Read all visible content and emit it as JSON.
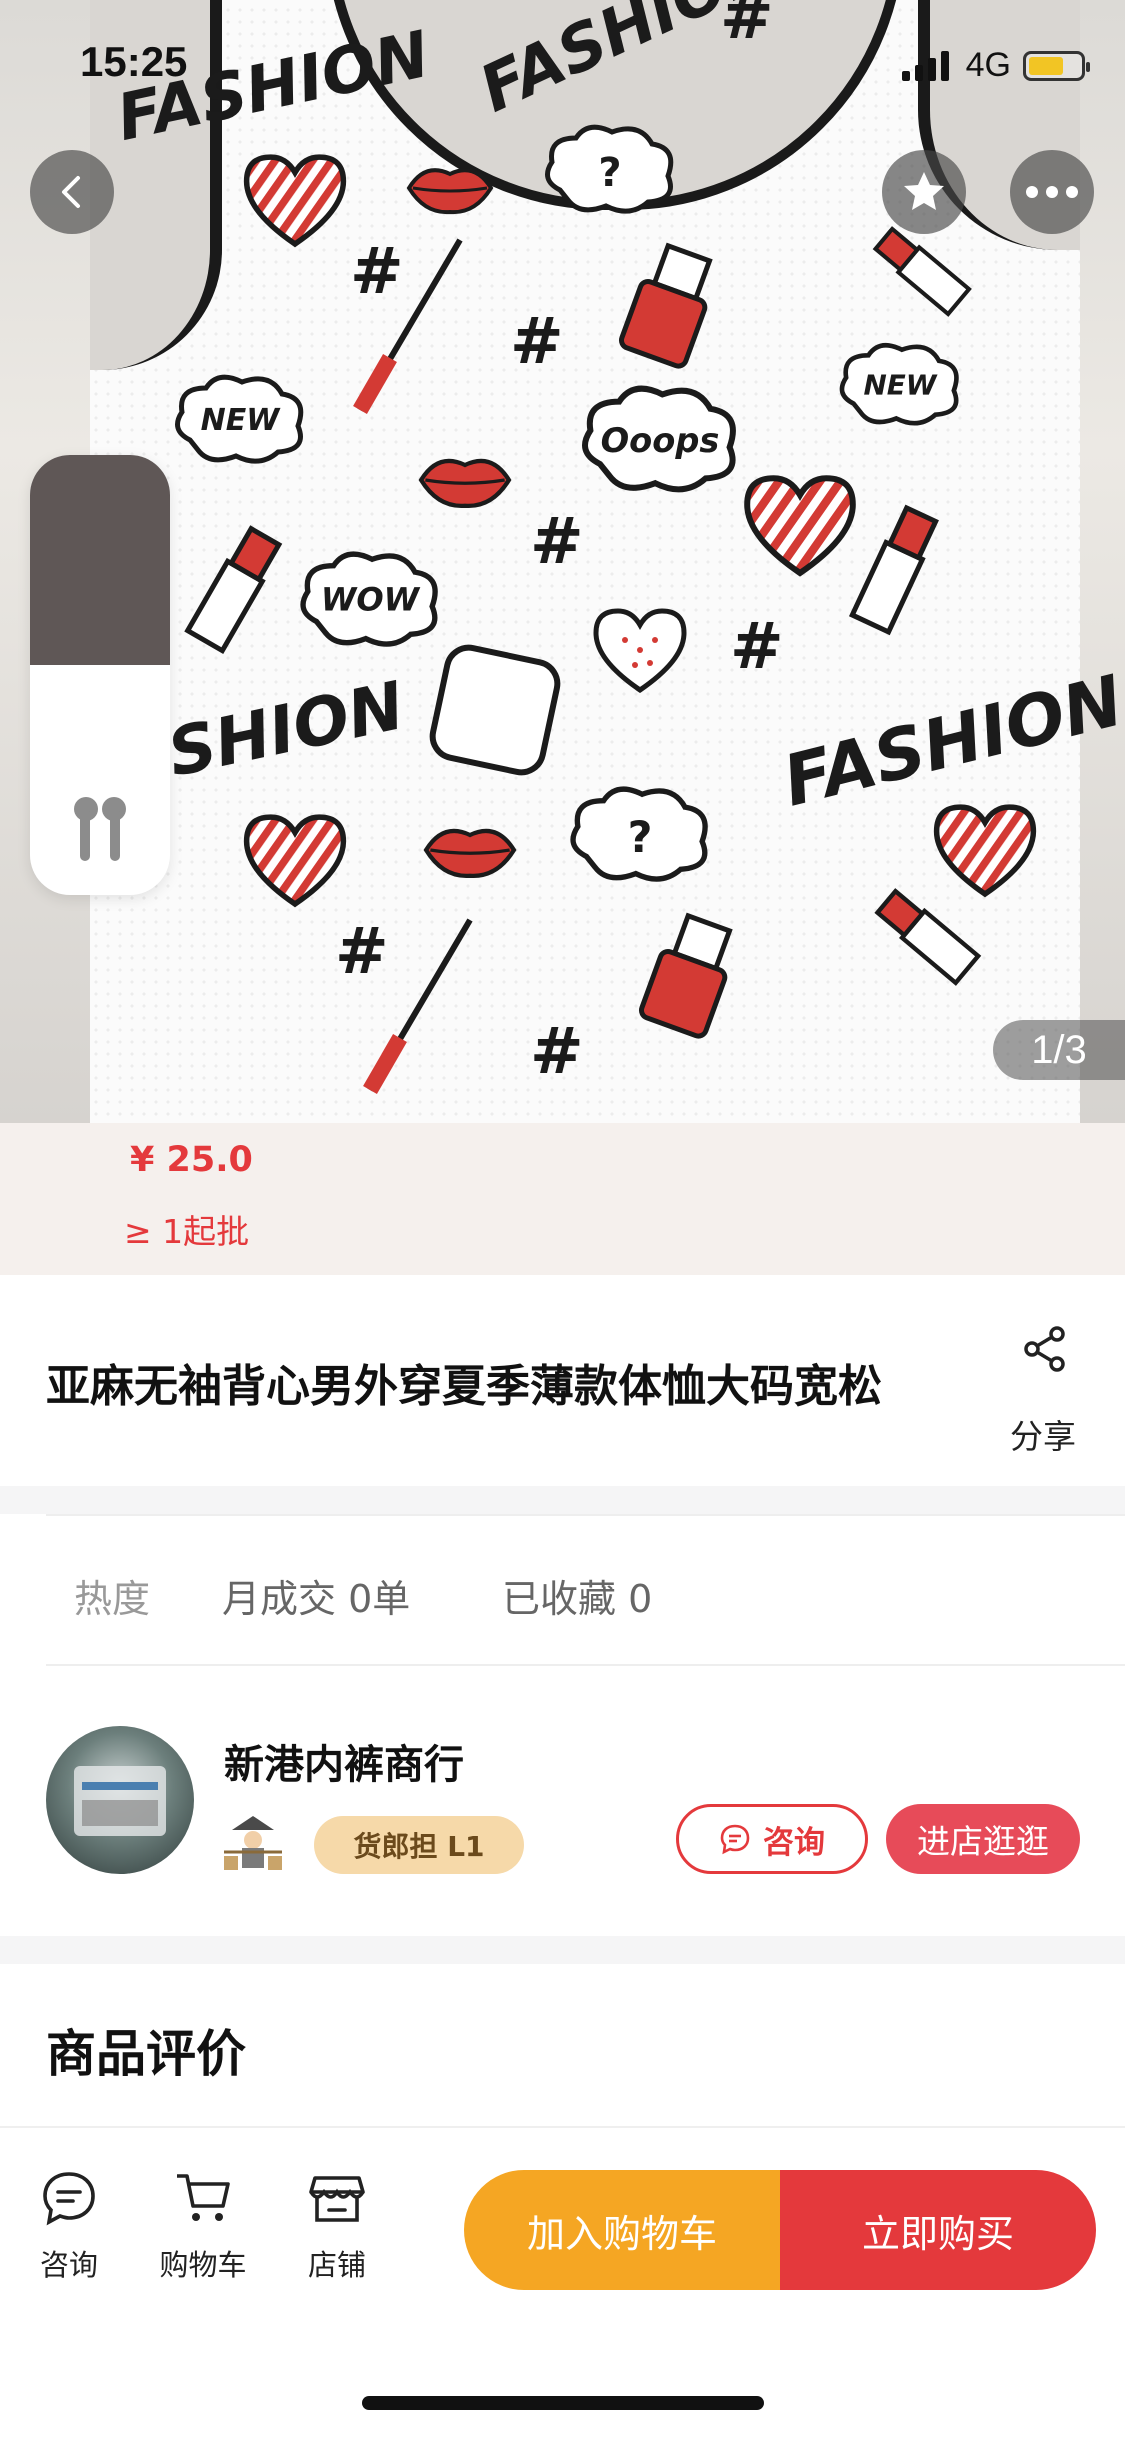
{
  "status_bar": {
    "time": "15:25",
    "network": "4G"
  },
  "gallery": {
    "page_indicator": "1/3",
    "print_words": {
      "fashion": "FASHION",
      "new": "NEW",
      "wow": "WOW",
      "ooops": "Ooops",
      "question": "?",
      "hash": "#"
    }
  },
  "price": {
    "value": "¥ 25.0",
    "min_qty": "≥ 1起批"
  },
  "product": {
    "title": "亚麻无袖背心男外穿夏季薄款体恤大码宽松",
    "share_label": "分享"
  },
  "stats": {
    "heat_label": "热度",
    "monthly_sales": "月成交 0单",
    "favorites": "已收藏 0"
  },
  "shop": {
    "name": "新港内裤商行",
    "level_badge": "货郎担 L1",
    "consult_label": "咨询",
    "visit_label": "进店逛逛"
  },
  "reviews": {
    "title": "商品评价"
  },
  "bottom_bar": {
    "consult": "咨询",
    "cart": "购物车",
    "store": "店铺",
    "add_to_cart": "加入购物车",
    "buy_now": "立即购买"
  },
  "colors": {
    "accent_red": "#e4393c",
    "cart_orange": "#f5a623",
    "badge_gold": "#f6d9a9"
  }
}
